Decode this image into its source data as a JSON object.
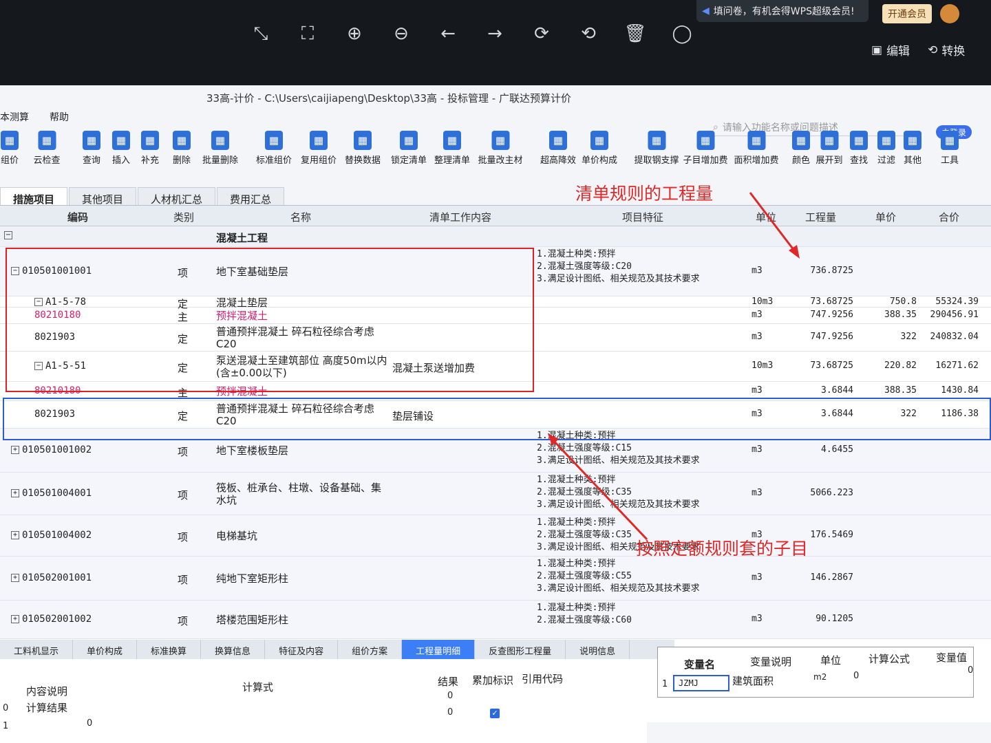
{
  "viewer": {
    "tools": [
      "⤡",
      "⛶",
      "⊕",
      "⊖",
      "←",
      "→",
      "⟳",
      "⟲",
      "🗑",
      "◯"
    ],
    "wps_notice": "填问卷，有机会得WPS超级会员!",
    "vip_label": "开通会员",
    "edit_label": "编辑",
    "convert_label": "转换"
  },
  "app": {
    "title": "33高-计价 - C:\\Users\\caijiapeng\\Desktop\\33高 - 投标管理 - 广联达预算计价",
    "menu": [
      "本测算",
      "帮助"
    ],
    "search_placeholder": "请输入功能名称或问题描述",
    "login_label": "未登录"
  },
  "ribbon": [
    "组价",
    "云检查",
    "查询",
    "插入",
    "补充",
    "删除",
    "批量删除",
    "标准组价",
    "复用组价",
    "替换数据",
    "锁定清单",
    "整理清单",
    "批量改主材",
    "超高降效",
    "单价构成",
    "提取钢支撑",
    "子目增加费",
    "面积增加费",
    "颜色",
    "展开到",
    "查找",
    "过滤",
    "其他",
    "工具"
  ],
  "tabs": [
    "措施项目",
    "其他项目",
    "人材机汇总",
    "费用汇总"
  ],
  "columns": {
    "code": "编码",
    "type": "类别",
    "name": "名称",
    "work": "清单工作内容",
    "feature": "项目特征",
    "unit": "单位",
    "qty": "工程量",
    "price": "单价",
    "total": "合价"
  },
  "section": "混凝土工程",
  "rows": [
    {
      "code": "010501001001",
      "type": "项",
      "name": "地下室基础垫层",
      "work": "",
      "feature": [
        "1.混凝土种类:预拌",
        "2.混凝土强度等级:C20",
        "3.满足设计图纸、相关规范及其技术要求"
      ],
      "unit": "m3",
      "qty": "736.8725",
      "price": "",
      "total": ""
    },
    {
      "code": "A1-5-78",
      "type": "定",
      "name": "混凝土垫层",
      "work": "",
      "feature": [],
      "unit": "10m3",
      "qty": "73.68725",
      "price": "750.8",
      "total": "55324.39"
    },
    {
      "code": "80210180",
      "type": "主",
      "name": "预拌混凝土",
      "work": "",
      "feature": [],
      "unit": "m3",
      "qty": "747.9256",
      "price": "388.35",
      "total": "290456.91"
    },
    {
      "code": "8021903",
      "type": "定",
      "name": "普通预拌混凝土 碎石粒径综合考虑 C20",
      "work": "",
      "feature": [],
      "unit": "m3",
      "qty": "747.9256",
      "price": "322",
      "total": "240832.04"
    },
    {
      "code": "A1-5-51",
      "type": "定",
      "name": "泵送混凝土至建筑部位 高度50m以内(含±0.00以下)",
      "work": "混凝土泵送增加费",
      "feature": [],
      "unit": "10m3",
      "qty": "73.68725",
      "price": "220.82",
      "total": "16271.62"
    },
    {
      "code": "80210180",
      "type": "主",
      "name": "预拌混凝土",
      "work": "",
      "feature": [],
      "unit": "m3",
      "qty": "3.6844",
      "price": "388.35",
      "total": "1430.84"
    },
    {
      "code": "8021903",
      "type": "定",
      "name": "普通预拌混凝土 碎石粒径综合考虑 C20",
      "work": "垫层铺设",
      "feature": [],
      "unit": "m3",
      "qty": "3.6844",
      "price": "322",
      "total": "1186.38"
    },
    {
      "code": "010501001002",
      "type": "项",
      "name": "地下室楼板垫层",
      "work": "",
      "feature": [
        "1.混凝土种类:预拌",
        "2.混凝土强度等级:C15",
        "3.满足设计图纸、相关规范及其技术要求"
      ],
      "unit": "m3",
      "qty": "4.6455",
      "price": "",
      "total": ""
    },
    {
      "code": "010501004001",
      "type": "项",
      "name": "筏板、桩承台、柱墩、设备基础、集水坑",
      "work": "",
      "feature": [
        "1.混凝土种类:预拌",
        "2.混凝土强度等级:C35",
        "3.满足设计图纸、相关规范及其技术要求"
      ],
      "unit": "m3",
      "qty": "5066.223",
      "price": "",
      "total": ""
    },
    {
      "code": "010501004002",
      "type": "项",
      "name": "电梯基坑",
      "work": "",
      "feature": [
        "1.混凝土种类:预拌",
        "2.混凝土强度等级:C35",
        "3.满足设计图纸、相关规范及其技术要求"
      ],
      "unit": "m3",
      "qty": "176.5469",
      "price": "",
      "total": ""
    },
    {
      "code": "010502001001",
      "type": "项",
      "name": "纯地下室矩形柱",
      "work": "",
      "feature": [
        "1.混凝土种类:预拌",
        "2.混凝土强度等级:C55",
        "3.满足设计图纸、相关规范及其技术要求"
      ],
      "unit": "m3",
      "qty": "146.2867",
      "price": "",
      "total": ""
    },
    {
      "code": "010502001002",
      "type": "项",
      "name": "塔楼范围矩形柱",
      "work": "",
      "feature": [
        "1.混凝土种类:预拌",
        "2.混凝土强度等级:C60"
      ],
      "unit": "m3",
      "qty": "90.1205",
      "price": "",
      "total": ""
    }
  ],
  "annotations": {
    "top": "清单规则的工程量",
    "bottom": "按照定额规则套的子目"
  },
  "bottom_tabs": [
    "工料机显示",
    "单价构成",
    "标准换算",
    "换算信息",
    "特征及内容",
    "组价方案",
    "工程量明细",
    "反查图形工程量",
    "说明信息"
  ],
  "detail": {
    "col_formula": "计算式",
    "col_result": "结果",
    "col_accum": "累加标识",
    "col_ref": "引用代码",
    "row1_label": "内容说明",
    "row2_label": "计算结果",
    "r0": "0",
    "r1": "1",
    "v0": "0",
    "v1": "0",
    "v2": "0"
  },
  "vars": {
    "col_name": "变量名",
    "col_desc": "变量说明",
    "col_unit": "单位",
    "col_formula": "计算公式",
    "col_value": "变量值",
    "idx": "1",
    "name": "JZMJ",
    "desc": "建筑面积",
    "unit": "m2",
    "formula": "0",
    "value": "0"
  }
}
